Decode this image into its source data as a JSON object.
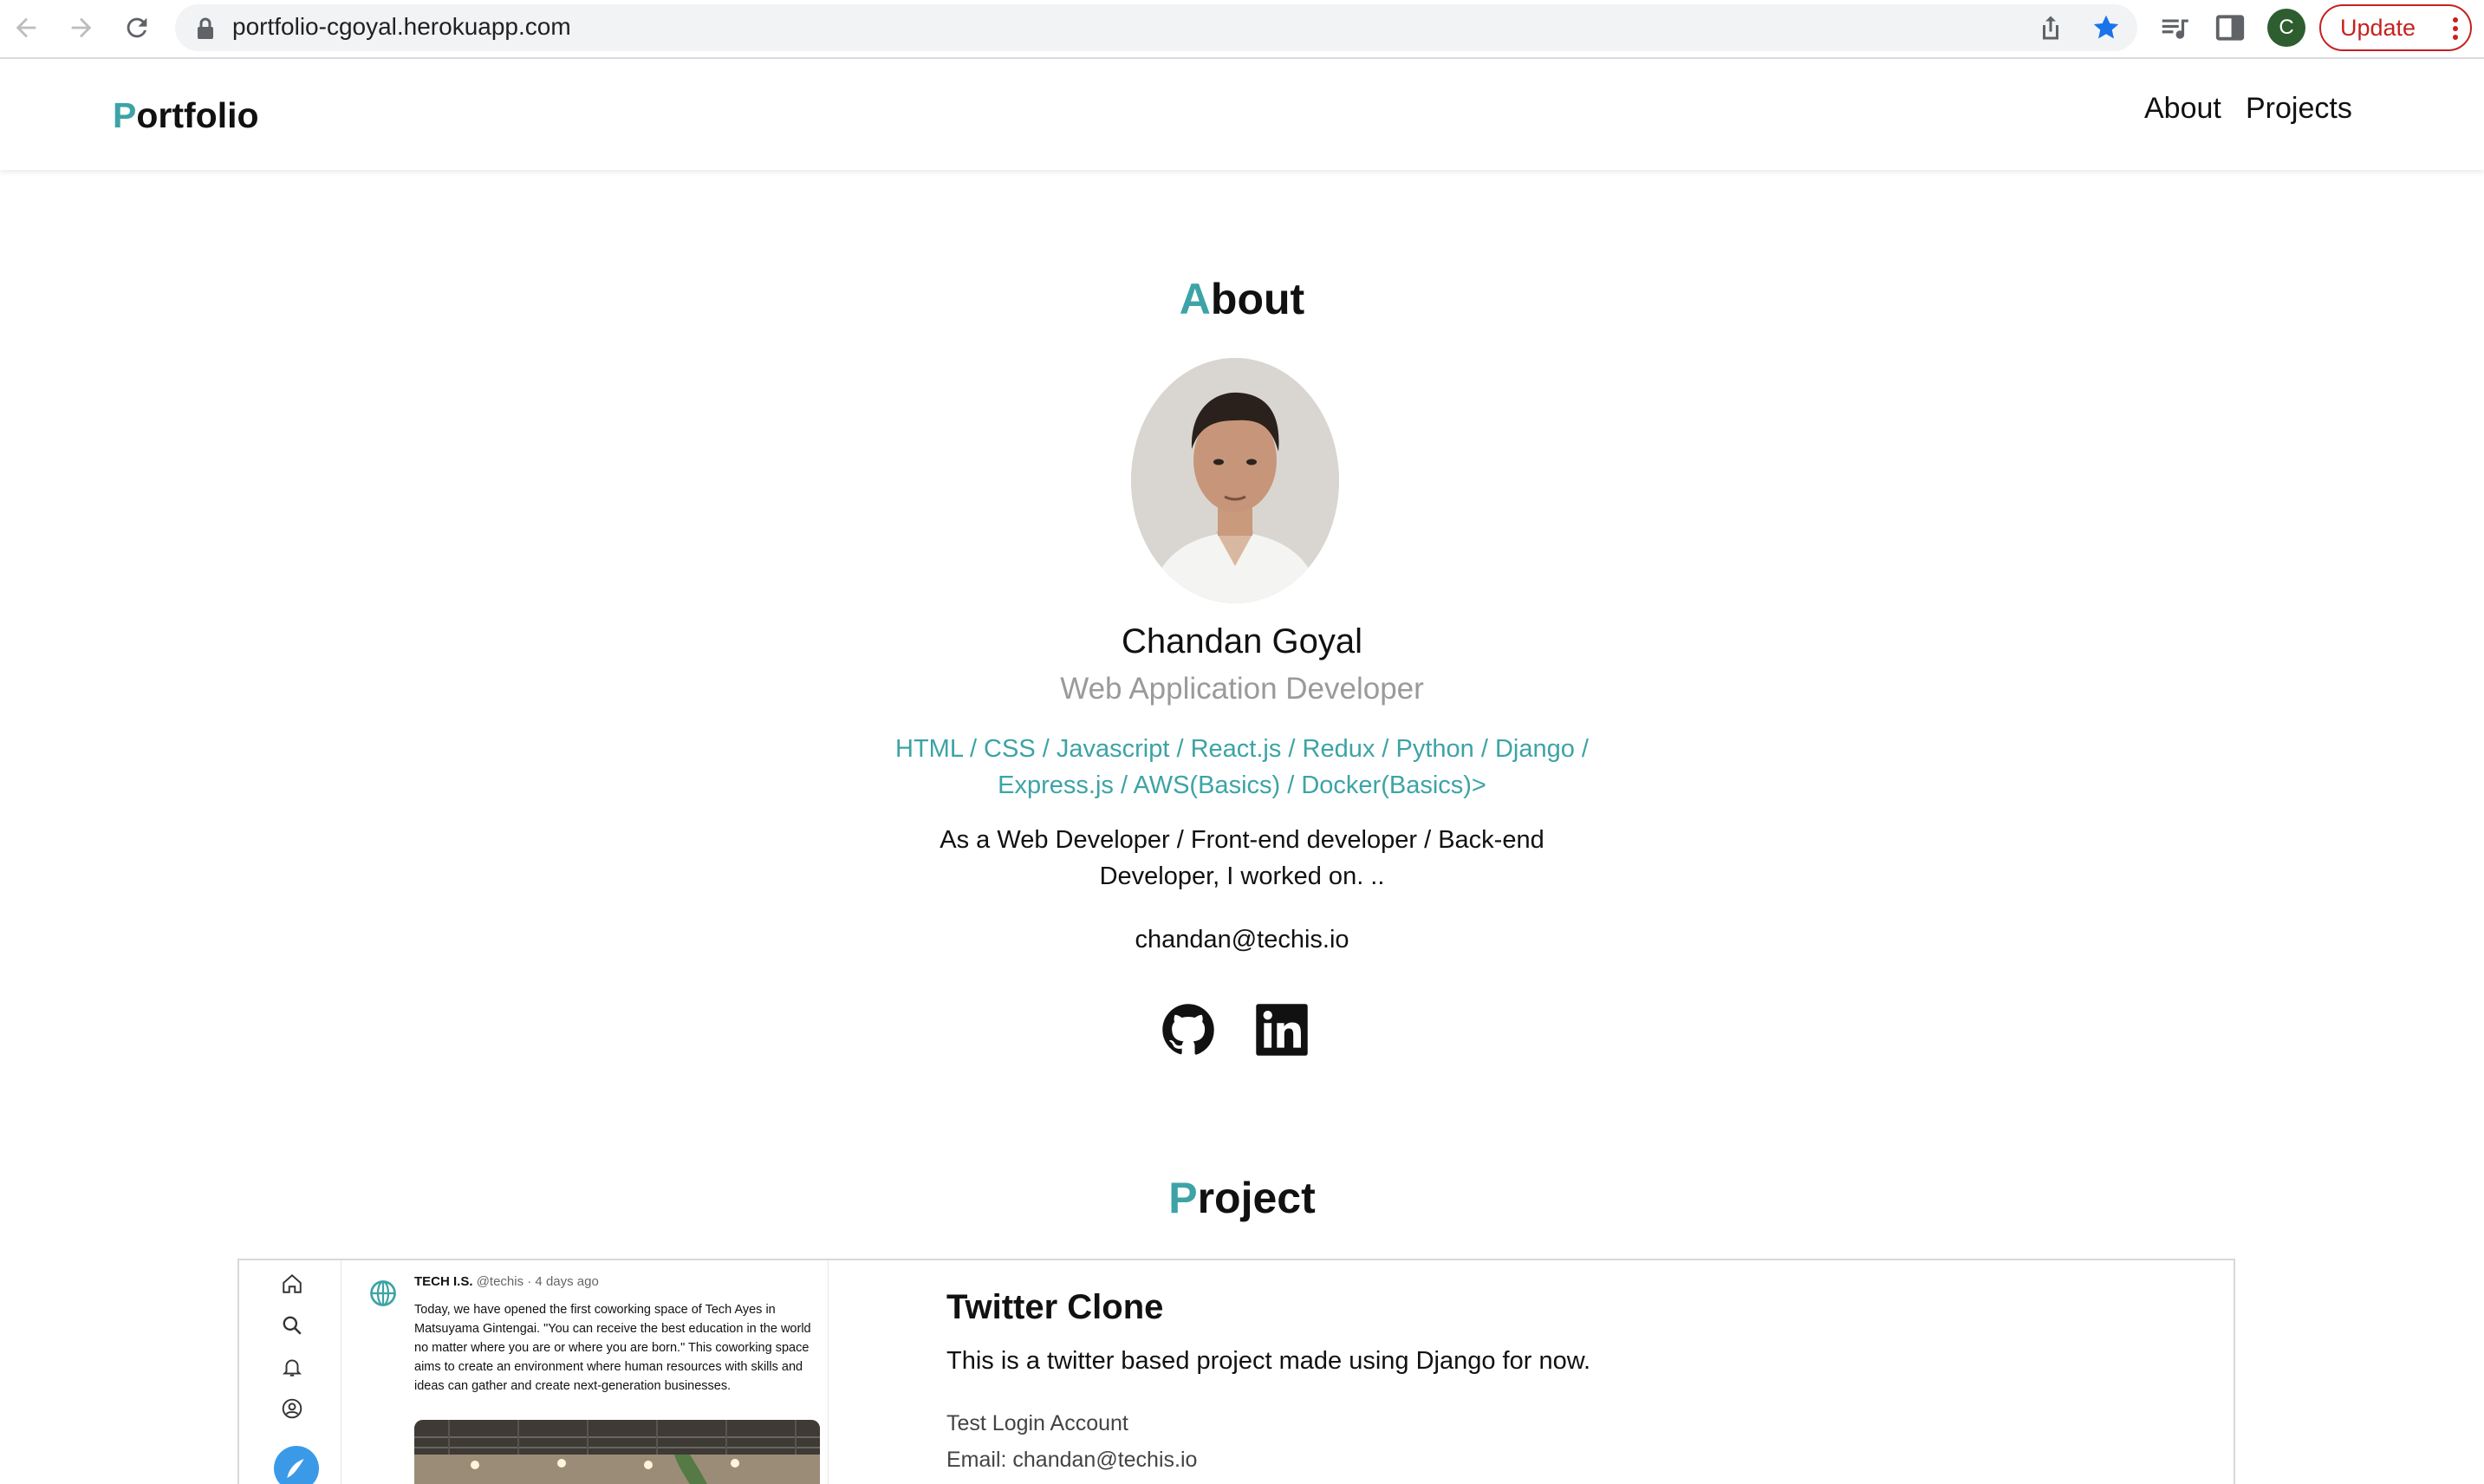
{
  "browser": {
    "url": "portfolio-cgoyal.herokuapp.com",
    "profile_initial": "C",
    "update_label": "Update",
    "accent_color": "#c5221f",
    "bookmark_color": "#1a73e8"
  },
  "header": {
    "brand_initial": "P",
    "brand_rest": "ortfolio",
    "nav": [
      "About",
      "Projects"
    ]
  },
  "about": {
    "title_initial": "A",
    "title_rest": "bout",
    "name": "Chandan Goyal",
    "role": "Web Application Developer",
    "skills": "HTML / CSS / Javascript / React.js / Redux / Python / Django / Express.js / AWS(Basics) / Docker(Basics)>",
    "bio": "As a Web Developer / Front-end developer / Back-end Developer, I worked on. ..",
    "email": "chandan@techis.io",
    "social_icons": [
      "github-icon",
      "linkedin-icon"
    ]
  },
  "project": {
    "title_initial": "P",
    "title_rest": "roject",
    "card": {
      "title": "Twitter Clone",
      "description": "This is a twitter based project made using Django for now.",
      "login_label": "Test Login Account",
      "email_line": "Email: chandan@techis.io",
      "thumbnail": {
        "author": "TECH I.S.",
        "handle_time": "@techis · 4 days ago",
        "text": "Today, we have opened the first coworking space of Tech Ayes in Matsuyama Gintengai. \"You can receive the best education in the world no matter where you are or where you are born.\" This coworking space aims to create an environment where human resources with skills and ideas can gather and create next-generation businesses."
      }
    }
  },
  "theme": {
    "accent": "#3da3a6",
    "muted": "#9a9a9a"
  }
}
